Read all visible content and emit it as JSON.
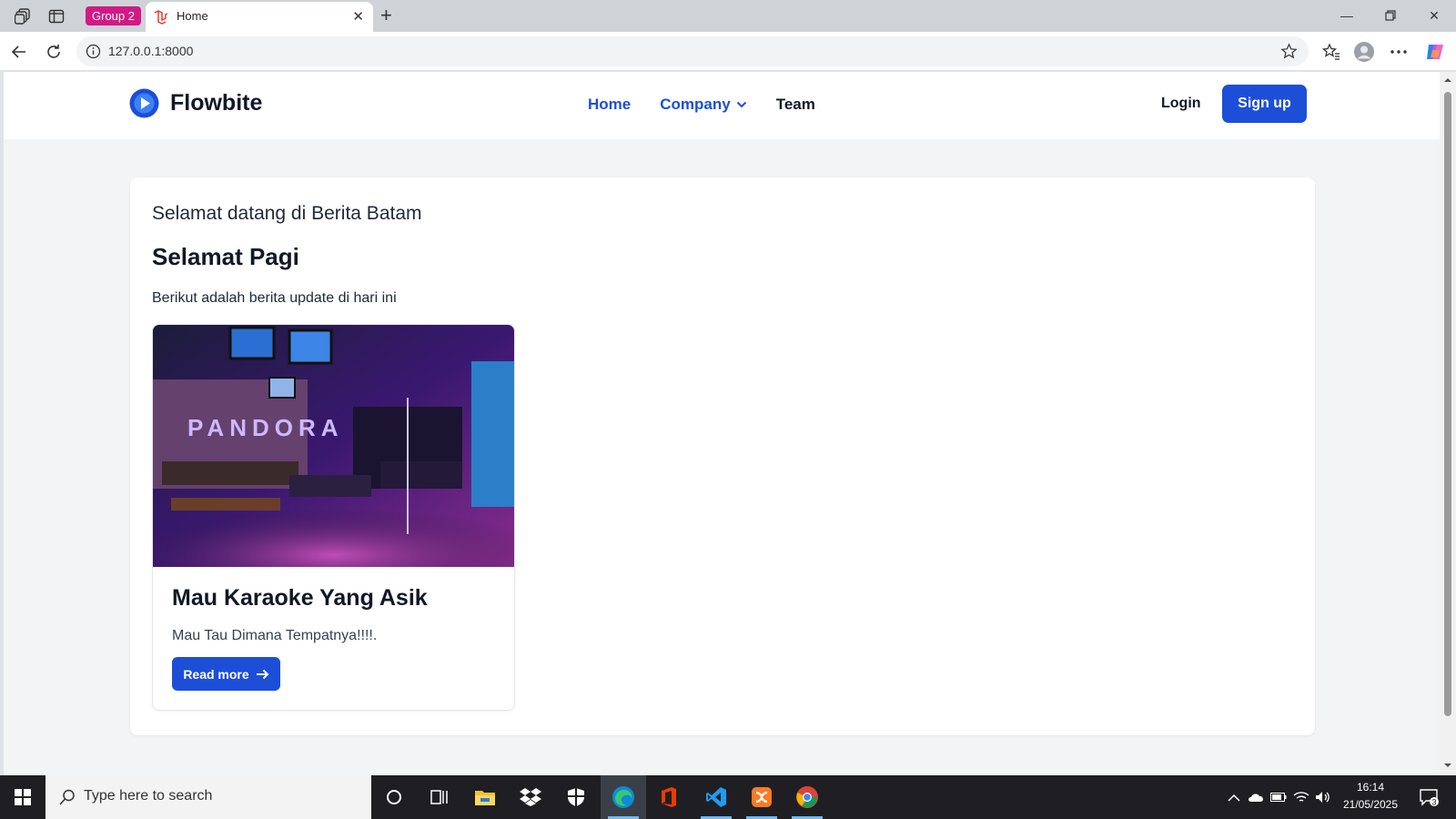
{
  "browser": {
    "tab_group_label": "Group 2",
    "tab_title": "Home",
    "url": "127.0.0.1:8000"
  },
  "site": {
    "brand": "Flowbite",
    "nav": {
      "home": "Home",
      "company": "Company",
      "team": "Team"
    },
    "login": "Login",
    "signup": "Sign up",
    "colors": {
      "primary": "#1d4ed8",
      "page_bg": "#f3f4f6"
    }
  },
  "content": {
    "welcome": "Selamat datang di Berita Batam",
    "greeting": "Selamat Pagi",
    "intro": "Berikut adalah berita update di hari ini",
    "card": {
      "title": "Mau Karaoke Yang Asik",
      "text": "Mau Tau Dimana Tempatnya!!!!.",
      "button": "Read more",
      "image_sign": "PANDORA"
    }
  },
  "taskbar": {
    "search_placeholder": "Type here to search",
    "time": "16:14",
    "date": "21/05/2025",
    "notifications": "3"
  }
}
